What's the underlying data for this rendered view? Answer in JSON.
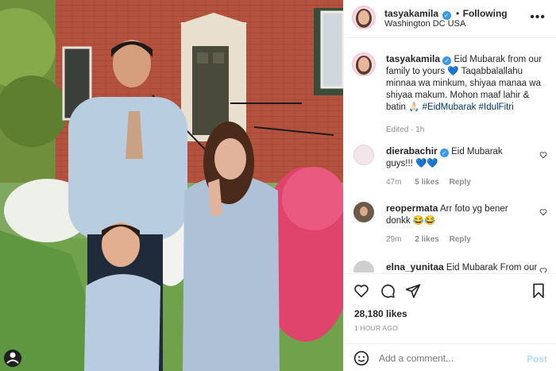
{
  "post": {
    "username": "tasyakamila",
    "follow_status": "Following",
    "location": "Washington DC USA",
    "more_menu": "more-options",
    "photo_caption": ""
  },
  "caption": {
    "username": "tasyakamila",
    "text": "Eid Mubarak from our family to yours 💙 Taqabbalallahu minnaa wa minkum, shiyaa manaa wa shiyaa makum. Mohon maaf lahir & batin 🙏🏻",
    "hashtags": "#EidMubarak #IdulFitri",
    "edited": "Edited · 1h"
  },
  "comments": [
    {
      "username": "dierabachir",
      "text": "Eid Mubarak guys!!! 💙💙",
      "time": "47m",
      "likes": "5 likes",
      "reply": "Reply"
    },
    {
      "username": "reopermata",
      "text": "Arr foto yg bener donkk 😂😂",
      "time": "29m",
      "likes": "2 likes",
      "reply": "Reply"
    },
    {
      "username": "elna_yunitaa",
      "text": "Eid Mubarak From our"
    }
  ],
  "stats": {
    "likes": "28,180 likes",
    "posted": "1 HOUR AGO"
  },
  "composer": {
    "placeholder": "Add a comment...",
    "post_label": "Post"
  },
  "colors": {
    "accent": "#3897f0",
    "text": "#262626",
    "muted": "#8e8e8e",
    "link": "#00376b"
  }
}
